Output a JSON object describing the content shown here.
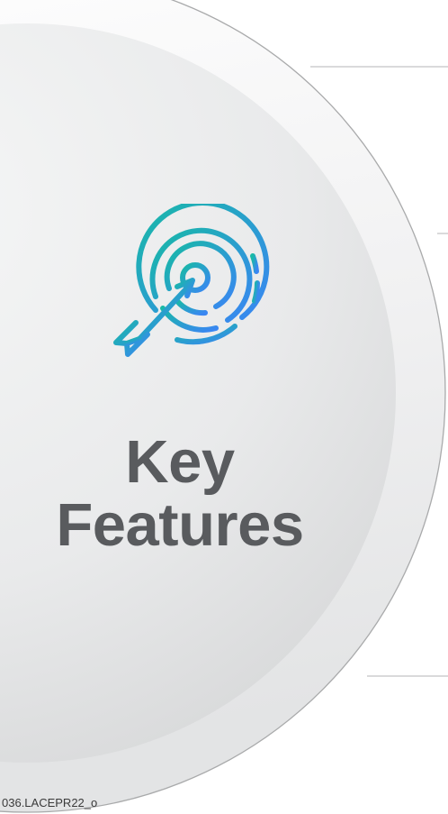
{
  "slide": {
    "title_line1": "Key",
    "title_line2": "Features",
    "footer_code": "036.LACEPR22_o"
  },
  "icons": {
    "main": "target-arrow-icon"
  },
  "colors": {
    "title": "#595b5e",
    "circle_light": "#f2f3f3",
    "circle_dark": "#d8d9da",
    "ring_edge": "#a9aaab",
    "icon_gradient_start": "#18b9a6",
    "icon_gradient_end": "#3a86f3"
  }
}
